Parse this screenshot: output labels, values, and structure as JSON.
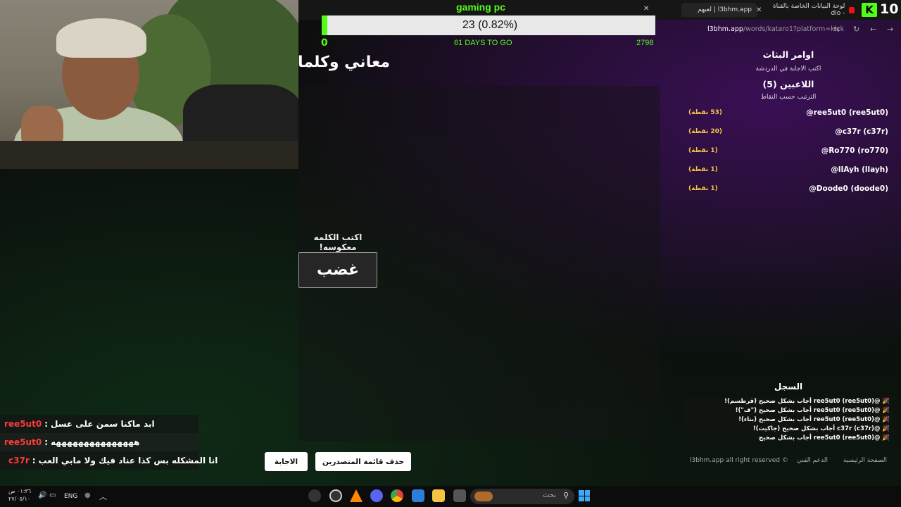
{
  "browser": {
    "tabs": [
      {
        "title": "l3bhm.app | لعبهم",
        "active": true
      },
      {
        "title": "لوحة البيانات الخاصة بالقناة - dio",
        "active": false
      }
    ],
    "viewer_count": "10",
    "url_host": "l3bhm.app",
    "url_path": "/words/kataro1?platform=kick"
  },
  "goal": {
    "title": "gaming pc",
    "value_text": "23 (0.82%)",
    "progress_fraction": 0.0082,
    "min": "0",
    "days_to_go": "61 DAYS TO GO",
    "max": "2798"
  },
  "game": {
    "title": "معاني وكلمات",
    "prompt": "اكتب الكلمه معكوسه!",
    "word": "غضب"
  },
  "sidebar": {
    "commands_title": "اوامر البثاث",
    "commands_sub": "اكتب الاجابة في الدردشة",
    "players_title": "اللاعبين (5)",
    "players_sub": "الترتيب حسب النقاط",
    "players": [
      {
        "name": "@ree5ut0 (ree5ut0)",
        "score": "(53 نقطة)"
      },
      {
        "name": "@c37r (c37r)",
        "score": "(20 نقطة)"
      },
      {
        "name": "@Ro770 (ro770)",
        "score": "(1 نقطة)"
      },
      {
        "name": "@lIAyh (llayh)",
        "score": "(1 نقطة)"
      },
      {
        "name": "@Doode0 (doode0)",
        "score": "(1 نقطة)"
      }
    ],
    "log_title": "السجل",
    "log": [
      "🎉 @ree5ut0 (ree5ut0) أجاب بشكل صحيح (قرطسم)!",
      "🎉 @ree5ut0 (ree5ut0) أجاب بشكل صحيح (\"ف\")!",
      "🎉 @ree5ut0 (ree5ut0) أجاب بشكل صحيح (بناء)!",
      "🎉 @c37r (c37r) أجاب بشكل صحيح (جاكيت)!",
      "🎉 @ree5ut0 (ree5ut0) أجاب بشكل صحيح"
    ],
    "footer": {
      "home": "الصفحة الرئيسية",
      "support": "الدعم الفني",
      "rights": "l3bhm.app all right reserved ©"
    }
  },
  "buttons": {
    "clear_leaderboard": "حذف قائمة المتصدرين",
    "answer": "الاجابة"
  },
  "chat": [
    {
      "user": "ree5ut0",
      "message": "ابد ماكنا سمن على عسل",
      "badge": false
    },
    {
      "user": "ree5ut0",
      "message": "هههههههههههههههه",
      "badge": false
    },
    {
      "user": "c37r",
      "message": "انا المشكله بس كذا عناد فيك ولا مابي العب",
      "badge": true
    }
  ],
  "taskbar": {
    "time": "٠١:٣٦ ص",
    "date": "٢٧/٠٥/١٠",
    "lang": "ENG",
    "search_placeholder": "بحث"
  },
  "colors": {
    "kick_green": "#53fc18",
    "score_gold": "#f5c542",
    "chat_user_red": "#ff3b3b"
  }
}
